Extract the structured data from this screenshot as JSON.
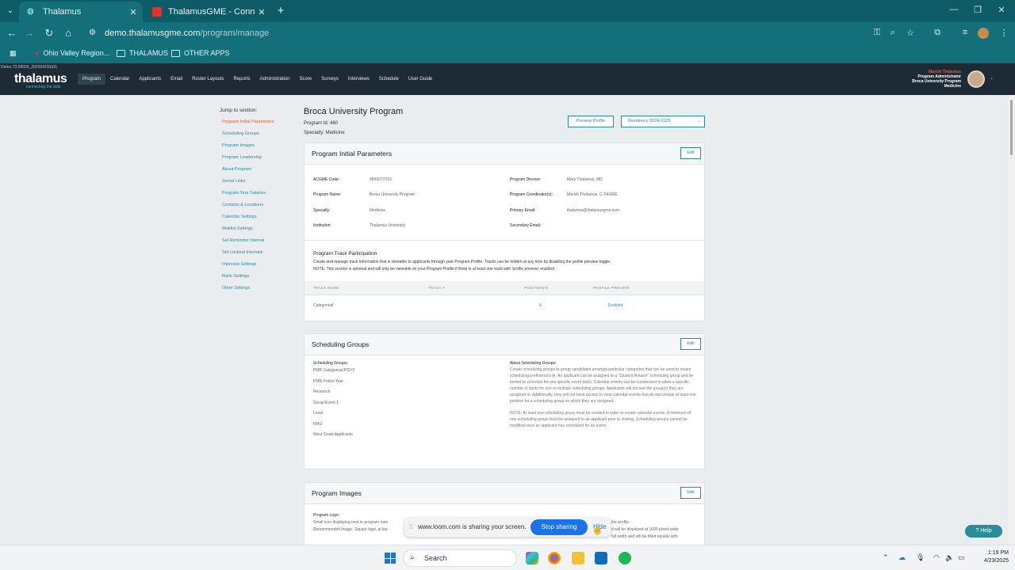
{
  "browser": {
    "tabs": [
      {
        "title": "Thalamus",
        "active": true
      },
      {
        "title": "ThalamusGME - Connecting the",
        "active": false
      }
    ],
    "url_host": "demo.thalamusgme.com",
    "url_path": "/program/manage",
    "bookmarks": [
      "Ohio Valley Region...",
      "THALAMUS",
      "OTHER APPS"
    ]
  },
  "app": {
    "version": "Demo.73.08026_20250423/(d3)",
    "logo_text": "thalamus",
    "logo_tagline": "connecting the dots",
    "nav": [
      "Program",
      "Calendar",
      "Applicants",
      "Email",
      "Roster Layouts",
      "Reports",
      "Administration",
      "Score",
      "Surveys",
      "Interviews",
      "Schedule",
      "User Guide"
    ],
    "user": {
      "name": "Marish Thalamus",
      "role": "Program Administrator",
      "program": "Broca University Program",
      "specialty": "Medicine"
    }
  },
  "jump": {
    "title": "Jump to section:",
    "items": [
      "Program Initial Parameters",
      "Scheduling Groups",
      "Program Images",
      "Program Leadership",
      "About Program",
      "Social Links",
      "Program Year Salaries",
      "Contacts & Locations",
      "Calendar Settings",
      "Waitlist Settings",
      "Set Reminder Interval",
      "Set Lockout Intervals",
      "Interview Settings",
      "Rank Settings",
      "Other Settings"
    ]
  },
  "program": {
    "title": "Broca University Program",
    "id_line": "Program Id: 460",
    "specialty_line": "Specialty: Medicine",
    "preview_label": "Preview Profile",
    "cycle": "Residency 2024-2025"
  },
  "initial": {
    "title": "Program Initial Parameters",
    "edit": "Edit",
    "left": [
      {
        "k": "ACGME Code:",
        "v": "4806077210"
      },
      {
        "k": "Program Name:",
        "v": "Broca University Program"
      },
      {
        "k": "Specialty:",
        "v": "Medicine"
      },
      {
        "k": "Institution:",
        "v": "Thalamus University"
      }
    ],
    "right": [
      {
        "k": "Program Director:",
        "v": "Mary Thalamus, MD"
      },
      {
        "k": "Program Coordinator(s):",
        "v": "Marish Thalamus, C-TAGME"
      },
      {
        "k": "Primary Email:",
        "v": "thalamus@thalamusgme.com"
      },
      {
        "k": "Secondary Email:",
        "v": ""
      }
    ],
    "track_title": "Program Track Participation",
    "track_desc_1": "Create and manage track information that is viewable to applicants through your Program Profile. Tracks can be hidden at any time by disabling the profile preview toggle.",
    "track_desc_2": "NOTE: This section is optional and will only be viewable on your Program Profile if there is at least one track with 'profile preview' enabled.",
    "columns": [
      "TRACK NAME",
      "TRACK #",
      "POSITION(S)",
      "PROFILE PREVIEW"
    ],
    "rows": [
      {
        "name": "Categorical",
        "num": "",
        "positions": "6",
        "preview": "Enabled"
      }
    ]
  },
  "scheduling": {
    "title": "Scheduling Groups",
    "edit": "Edit",
    "list_head": "Scheduling Groups:",
    "groups": [
      "PMR Categorical PGY2",
      "PMR Prelim Year",
      "Research",
      "Social Event 1",
      "Local",
      "FMG",
      "West Coast Applicants"
    ],
    "about_head": "About Scheduling Groups:",
    "about_p1": "Create scheduling groups to group candidates amongst particular categories that can be used to create scheduling preferences (e. An applicant can be assigned to a \"Student Rotator\" scheduling group and be invited to schedule for one specific event date). Calendar events can be customized to allow a specific number of spots for one or multiple scheduling groups. Applicants will not see the group(s) they are assigned to. Additionally, they will not have access to view calendar events that do not contain at least one position for a scheduling group on which they are assigned.",
    "about_p2": "NOTE: At least one scheduling group must be created in order to create calendar events. A minimum of one scheduling group must be assigned to an applicant prior to inviting. Scheduling groups cannot be modified once an applicant has scheduled for an event."
  },
  "images": {
    "title": "Program Images",
    "edit": "Edit",
    "logo_head": "Program Logo:",
    "logo_desc": "Small icon displaying next to program nam",
    "logo_rec": "Recommended image: Square logo, at lea",
    "right_a": "the profile.",
    "right_b": "d will be displayed at 1000 pixels wide",
    "right_c": "full width and will be filled equally with"
  },
  "loom": {
    "text": "www.loom.com is sharing your screen.",
    "stop": "Stop sharing",
    "hide": "Hide"
  },
  "help": "Help",
  "taskbar": {
    "search": "Search",
    "time": "1:19 PM",
    "date": "4/23/2025"
  },
  "colors": {
    "chrome": "#13707b",
    "app_header": "#1c2b35",
    "accent": "#2a8b9b",
    "active_link": "#e05a3b",
    "loom_button": "#1a73e8"
  }
}
